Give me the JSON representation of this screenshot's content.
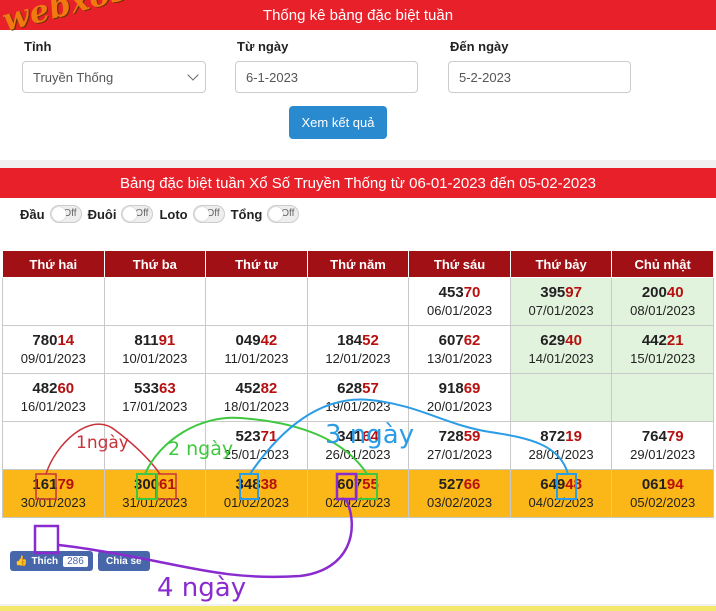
{
  "watermark": "webxoso.net",
  "search": {
    "title": "Thống kê bảng đặc biệt tuần",
    "province_label": "Tỉnh",
    "province_value": "Truyền Thống",
    "from_label": "Từ ngày",
    "from_value": "6-1-2023",
    "to_label": "Đến ngày",
    "to_value": "5-2-2023",
    "submit_label": "Xem kết quả"
  },
  "result": {
    "title": "Bảng đặc biệt tuần Xổ Số Truyền Thống từ 06-01-2023 đến 05-02-2023",
    "toggles": [
      {
        "label": "Đầu",
        "state": "Off"
      },
      {
        "label": "Đuôi",
        "state": "Off"
      },
      {
        "label": "Loto",
        "state": "Off"
      },
      {
        "label": "Tổng",
        "state": "Off"
      }
    ],
    "headers": [
      "Thứ hai",
      "Thứ ba",
      "Thứ tư",
      "Thứ năm",
      "Thứ sáu",
      "Thứ bảy",
      "Chủ nhật"
    ],
    "rows": [
      [
        null,
        null,
        null,
        null,
        {
          "head": "453",
          "tail": "70",
          "date": "06/01/2023"
        },
        {
          "head": "395",
          "tail": "97",
          "date": "07/01/2023",
          "green": true
        },
        {
          "head": "200",
          "tail": "40",
          "date": "08/01/2023",
          "green": true
        }
      ],
      [
        {
          "head": "780",
          "tail": "14",
          "date": "09/01/2023"
        },
        {
          "head": "811",
          "tail": "91",
          "date": "10/01/2023"
        },
        {
          "head": "049",
          "tail": "42",
          "date": "11/01/2023"
        },
        {
          "head": "184",
          "tail": "52",
          "date": "12/01/2023"
        },
        {
          "head": "607",
          "tail": "62",
          "date": "13/01/2023"
        },
        {
          "head": "629",
          "tail": "40",
          "date": "14/01/2023",
          "green": true
        },
        {
          "head": "442",
          "tail": "21",
          "date": "15/01/2023",
          "green": true
        }
      ],
      [
        {
          "head": "482",
          "tail": "60",
          "date": "16/01/2023"
        },
        {
          "head": "533",
          "tail": "63",
          "date": "17/01/2023"
        },
        {
          "head": "452",
          "tail": "82",
          "date": "18/01/2023"
        },
        {
          "head": "628",
          "tail": "57",
          "date": "19/01/2023"
        },
        {
          "head": "918",
          "tail": "69",
          "date": "20/01/2023"
        },
        {
          "green": true
        },
        {
          "green": true
        }
      ],
      [
        {
          "head": "",
          "tail": "",
          "date": ""
        },
        {
          "head": "",
          "tail": "",
          "date": ""
        },
        {
          "head": "523",
          "tail": "71",
          "date": "25/01/2023"
        },
        {
          "head": "341",
          "tail": "64",
          "date": "26/01/2023"
        },
        {
          "head": "728",
          "tail": "59",
          "date": "27/01/2023"
        },
        {
          "head": "872",
          "tail": "19",
          "date": "28/01/2023"
        },
        {
          "head": "764",
          "tail": "79",
          "date": "29/01/2023"
        }
      ],
      [
        {
          "head": "161",
          "tail": "79",
          "date": "30/01/2023"
        },
        {
          "head": "300",
          "tail": "61",
          "date": "31/01/2023"
        },
        {
          "head": "348",
          "tail": "38",
          "date": "01/02/2023"
        },
        {
          "head": "607",
          "tail": "55",
          "date": "02/02/2023"
        },
        {
          "head": "527",
          "tail": "66",
          "date": "03/02/2023"
        },
        {
          "head": "649",
          "tail": "48",
          "date": "04/02/2023"
        },
        {
          "head": "061",
          "tail": "94",
          "date": "05/02/2023"
        }
      ]
    ]
  },
  "social": {
    "like_label": "Thích",
    "like_count": "286",
    "share_label": "Chia sẻ"
  },
  "annotations": {
    "one_day": "1ngày",
    "two_days": "2 ngày",
    "three_days": "3 ngày",
    "four_days": "4 ngày",
    "colors": {
      "one": "#c8323a",
      "two": "#3fc83f",
      "three": "#2b9ce6",
      "four": "#8a2bd0"
    }
  },
  "colors": {
    "header_red": "#e8202a",
    "table_header": "#a01014",
    "highlight_row": "#fbb718",
    "weekend_green": "#e1f3dc",
    "button_blue": "#2a8ad0"
  }
}
